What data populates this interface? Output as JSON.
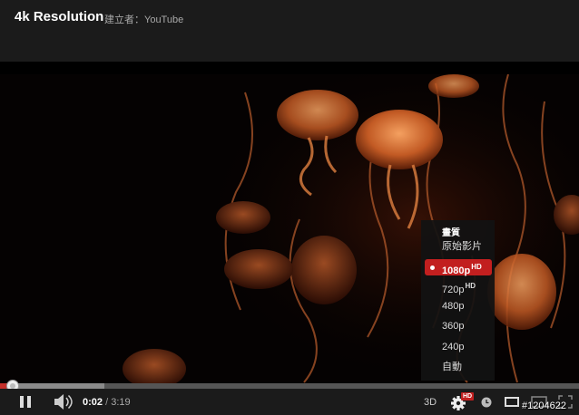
{
  "header": {
    "title": "4k Resolution",
    "byline": "建立者：YouTube"
  },
  "quality_menu": {
    "heading": "畫質",
    "items": [
      {
        "label": "原始影片",
        "badge": "",
        "selected": false
      },
      {
        "label": "1080p",
        "badge": "HD",
        "selected": true
      },
      {
        "label": "720p",
        "badge": "HD",
        "selected": false
      },
      {
        "label": "480p",
        "badge": "",
        "selected": false
      },
      {
        "label": "360p",
        "badge": "",
        "selected": false
      },
      {
        "label": "240p",
        "badge": "",
        "selected": false
      },
      {
        "label": "自動",
        "badge": "",
        "selected": false
      }
    ]
  },
  "player": {
    "current_time": "0:02",
    "separator": "/",
    "duration": "3:19",
    "three_d_label": "3D",
    "settings_badge": "HD",
    "played_fraction": 0.01,
    "loaded_fraction": 0.18
  },
  "watermark": "#1204622",
  "colors": {
    "accent": "#c21f1f",
    "header_bg": "#1b1b1b",
    "jellyfish": "#d0703a"
  }
}
